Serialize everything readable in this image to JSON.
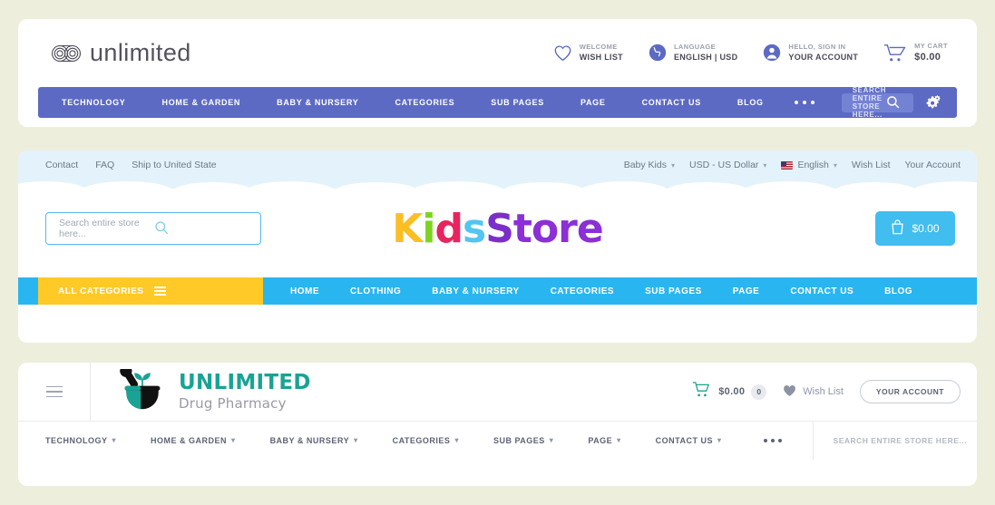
{
  "page": {
    "background": "#eeeedd"
  },
  "header_unlimited": {
    "logo": {
      "text": "unlimited",
      "icon": "infinity-knot-icon"
    },
    "accent": "#5c6ac4",
    "utilities": [
      {
        "icon": "heart-icon",
        "top": "WELCOME",
        "bottom": "WISH LIST"
      },
      {
        "icon": "globe-icon",
        "top": "LANGUAGE",
        "bottom": "ENGLISH | USD"
      },
      {
        "icon": "user-icon",
        "top": "HELLO, SIGN IN",
        "bottom": "YOUR ACCOUNT"
      },
      {
        "icon": "cart-icon",
        "top": "MY CART",
        "bottom": "$0.00"
      }
    ],
    "nav": [
      "TECHNOLOGY",
      "HOME & GARDEN",
      "BABY & NURSERY",
      "CATEGORIES",
      "SUB PAGES",
      "PAGE",
      "CONTACT US",
      "BLOG"
    ],
    "more_label": "•••",
    "search": {
      "placeholder": "SEARCH ENTIRE STORE HERE...",
      "icon": "search-icon"
    },
    "settings_icon": "gears-icon"
  },
  "header_kidsstore": {
    "topbar_bg": "#e4f2fb",
    "left_links": [
      "Contact",
      "FAQ",
      "Ship to United State"
    ],
    "right_links": [
      {
        "label": "Baby Kids",
        "caret": true
      },
      {
        "label": "USD - US Dollar",
        "caret": true
      },
      {
        "label": "English",
        "caret": true,
        "flag": "us-flag-icon"
      },
      {
        "label": "Wish List",
        "caret": false
      },
      {
        "label": "Your Account",
        "caret": false
      }
    ],
    "search": {
      "placeholder": "Search entire store here...",
      "icon": "search-icon"
    },
    "logo": {
      "letters": [
        {
          "ch": "K",
          "color": "#fbbf24"
        },
        {
          "ch": "i",
          "color": "#7ed321"
        },
        {
          "ch": "d",
          "color": "#e8245e"
        },
        {
          "ch": "s",
          "color": "#52c5f0"
        },
        {
          "ch": "S",
          "color": "#7b2fc9"
        },
        {
          "ch": "t",
          "color": "#8b2fd6"
        },
        {
          "ch": "o",
          "color": "#8b2fd6"
        },
        {
          "ch": "r",
          "color": "#8b2fd6"
        },
        {
          "ch": "e",
          "color": "#8b2fd6"
        }
      ]
    },
    "cart": {
      "label": "$0.00",
      "icon": "bag-icon",
      "color": "#41bdf0"
    },
    "all_categories": {
      "label": "ALL CATEGORIES",
      "icon": "hamburger-icon",
      "color": "#ffc928"
    },
    "nav_bg": "#29b6f0",
    "nav": [
      "HOME",
      "CLOTHING",
      "BABY & NURSERY",
      "CATEGORIES",
      "SUB PAGES",
      "PAGE",
      "CONTACT US",
      "BLOG"
    ]
  },
  "header_pharmacy": {
    "menu_icon": "hamburger-icon",
    "logo": {
      "icon": "mortar-pestle-icon",
      "line1": "UNLIMITED",
      "line2": "Drug Pharmacy",
      "accent": "#19a394"
    },
    "cart": {
      "icon": "cart-icon",
      "amount": "$0.00",
      "count": "0"
    },
    "wishlist": {
      "icon": "heart-icon",
      "label": "Wish List"
    },
    "account_button": "YOUR ACCOUNT",
    "nav": [
      {
        "label": "TECHNOLOGY",
        "caret": true
      },
      {
        "label": "HOME & GARDEN",
        "caret": true
      },
      {
        "label": "BABY & NURSERY",
        "caret": true
      },
      {
        "label": "CATEGORIES",
        "caret": true
      },
      {
        "label": "SUB PAGES",
        "caret": true
      },
      {
        "label": "PAGE",
        "caret": true
      },
      {
        "label": "CONTACT US",
        "caret": true
      }
    ],
    "more_label": "•••",
    "search": {
      "placeholder": "SEARCH ENTIRE STORE HERE...",
      "icon": "search-icon"
    },
    "settings_icon": "gears-icon"
  }
}
